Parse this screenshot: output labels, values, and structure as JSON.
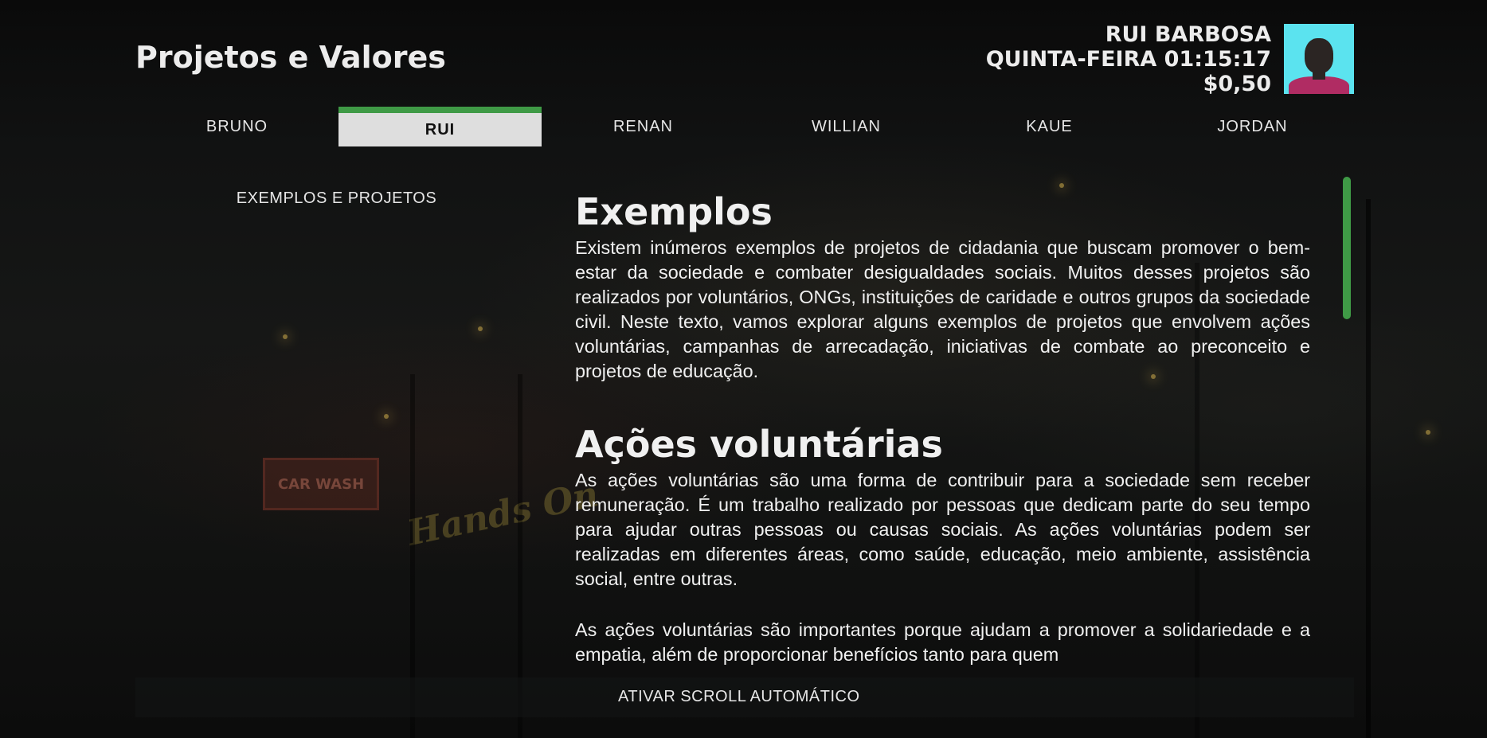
{
  "header": {
    "title": "Projetos e Valores"
  },
  "profile": {
    "name": "RUI BARBOSA",
    "datetime": "QUINTA-FEIRA 01:15:17",
    "balance": "$0,50"
  },
  "tabs": [
    {
      "label": "BRUNO",
      "active": false
    },
    {
      "label": "RUI",
      "active": true
    },
    {
      "label": "RENAN",
      "active": false
    },
    {
      "label": "WILLIAN",
      "active": false
    },
    {
      "label": "KAUE",
      "active": false
    },
    {
      "label": "JORDAN",
      "active": false
    }
  ],
  "sidebar": {
    "link": "EXEMPLOS E PROJETOS"
  },
  "content": {
    "sections": [
      {
        "heading": "Exemplos",
        "paragraphs": [
          "Existem inúmeros exemplos de projetos de cidadania que buscam promover o bem-estar da sociedade e combater desigualdades sociais. Muitos desses projetos são realizados por voluntários, ONGs, instituições de caridade e outros grupos da sociedade civil. Neste texto, vamos explorar alguns exemplos de projetos que envolvem ações voluntárias, campanhas de arrecadação, iniciativas de combate ao preconceito e projetos de educação."
        ]
      },
      {
        "heading": "Ações voluntárias",
        "paragraphs": [
          "As ações voluntárias são uma forma de contribuir para a sociedade sem receber remuneração. É um trabalho realizado por pessoas que dedicam parte do seu tempo para ajudar outras pessoas ou causas sociais. As ações voluntárias podem ser realizadas em diferentes áreas, como saúde, educação, meio ambiente, assistência social, entre outras.",
          "As ações voluntárias são importantes porque ajudam a promover a solidariedade e a empatia, além de proporcionar benefícios tanto para quem"
        ]
      }
    ]
  },
  "footer": {
    "auto_scroll_label": "ATIVAR SCROLL AUTOMÁTICO"
  },
  "colors": {
    "accent": "#3f9a46",
    "active_tab_bg": "#dedede",
    "avatar_bg": "#5be3ef"
  },
  "scroll": {
    "position_fraction": 0.0,
    "visible_fraction": 0.28
  }
}
